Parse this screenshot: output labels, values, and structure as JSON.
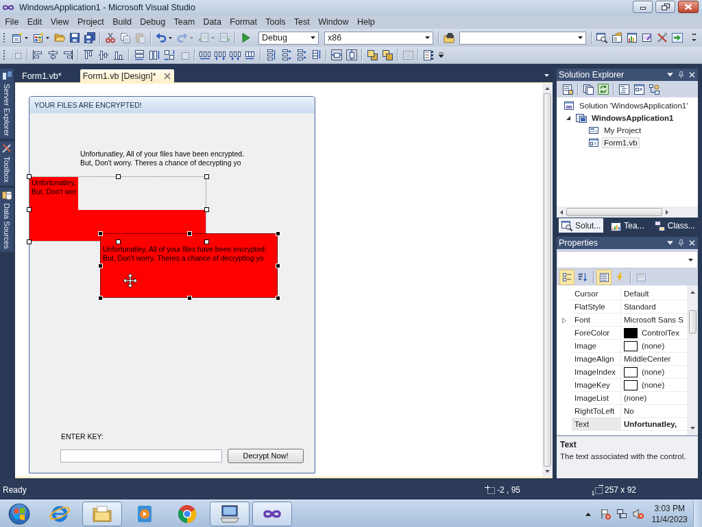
{
  "window": {
    "title": "WindowsApplication1 - Microsoft Visual Studio"
  },
  "menu": [
    "File",
    "Edit",
    "View",
    "Project",
    "Build",
    "Debug",
    "Team",
    "Data",
    "Format",
    "Tools",
    "Test",
    "Window",
    "Help"
  ],
  "standard_toolbar": {
    "configuration": "Debug",
    "platform": "x86",
    "buttons": [
      {
        "disabled": false
      },
      {
        "disabled": false
      },
      {
        "disabled": false
      },
      {
        "disabled": false
      },
      {
        "disabled": false
      },
      {
        "disabled": false
      },
      {
        "disabled": false
      },
      {
        "disabled": true
      },
      {
        "disabled": false
      },
      {
        "disabled": true
      },
      {
        "disabled": true
      },
      {
        "disabled": true
      },
      {
        "disabled": false
      },
      {
        "disabled": false
      },
      {
        "disabled": false
      },
      {
        "disabled": false
      },
      {
        "disabled": false
      },
      {
        "disabled": false
      },
      {
        "disabled": false
      },
      {
        "disabled": false
      }
    ]
  },
  "layout_toolbar": {
    "buttons": [
      {
        "disabled": true
      },
      {
        "disabled": false
      },
      {
        "disabled": false
      },
      {
        "disabled": false
      },
      {
        "disabled": false
      },
      {
        "disabled": false
      },
      {
        "disabled": false
      },
      {
        "disabled": false
      },
      {
        "disabled": false
      },
      {
        "disabled": false
      },
      {
        "disabled": true
      },
      {
        "disabled": false
      },
      {
        "disabled": false
      },
      {
        "disabled": false
      },
      {
        "disabled": false
      },
      {
        "disabled": false
      },
      {
        "disabled": false
      },
      {
        "disabled": false
      },
      {
        "disabled": false
      },
      {
        "disabled": false
      },
      {
        "disabled": false
      },
      {
        "disabled": false
      },
      {
        "disabled": false
      },
      {
        "disabled": true
      },
      {
        "disabled": false
      }
    ]
  },
  "side_tabs": [
    "Server Explorer",
    "Toolbox",
    "Data Sources"
  ],
  "document_tabs": [
    {
      "label": "Form1.vb*",
      "selected": false
    },
    {
      "label": "Form1.vb [Design]*",
      "selected": true
    }
  ],
  "form": {
    "title": "YOUR FILES ARE ENCRYPTED!",
    "controls": [
      {
        "kind": "label",
        "text": "Unfortunatley, All of your files have been encrypted.\nBut, Don't worry. Theres a chance of decrypting yo",
        "selected": false
      },
      {
        "kind": "label",
        "text": "Unfortunatley,\nBut, Don't wor",
        "color": "#ff0000",
        "selected": true,
        "primary": false
      },
      {
        "kind": "label",
        "text": "Unfortunatley, All of your files have been encrypted.\nBut, Don't worry. Theres a chance of decrypting yo",
        "color": "#ff0000",
        "selected": true,
        "primary": true
      },
      {
        "kind": "label",
        "text": "ENTER KEY:",
        "selected": false
      },
      {
        "kind": "textbox",
        "selected": false
      },
      {
        "kind": "button",
        "text": "Decrypt Now!",
        "selected": false
      }
    ]
  },
  "solution_explorer": {
    "title": "Solution Explorer",
    "tree": [
      {
        "kind": "solution",
        "label": "Solution 'WindowsApplication1'",
        "startup": false,
        "selected": false,
        "children": [
          {
            "kind": "project",
            "label": "WindowsApplication1",
            "startup": true,
            "selected": false,
            "expanded": true,
            "children": [
              {
                "kind": "folder",
                "label": "My Project",
                "startup": false,
                "selected": false
              },
              {
                "kind": "form",
                "label": "Form1.vb",
                "startup": false,
                "selected": true
              }
            ]
          }
        ]
      }
    ],
    "tabs": [
      {
        "label": "Solut...",
        "selected": true
      },
      {
        "label": "Tea...",
        "selected": false
      },
      {
        "label": "Class...",
        "selected": false
      }
    ]
  },
  "properties": {
    "title": "Properties",
    "toolbar": [
      {
        "selected": true,
        "disabled": false
      },
      {
        "selected": false,
        "disabled": false
      },
      {
        "selected": true,
        "disabled": false
      },
      {
        "selected": false,
        "disabled": false
      },
      {
        "selected": false,
        "disabled": true
      }
    ],
    "rows": [
      {
        "name": "Cursor",
        "value": "Default",
        "kind": "text",
        "modified": false,
        "selected": false
      },
      {
        "name": "FlatStyle",
        "value": "Standard",
        "kind": "text",
        "modified": false,
        "selected": false
      },
      {
        "name": "Font",
        "value": "Microsoft Sans S",
        "kind": "expandable",
        "expanded": false,
        "modified": false,
        "selected": false
      },
      {
        "name": "ForeColor",
        "value": "ControlTex",
        "kind": "swatch",
        "color": "#000000",
        "modified": false,
        "selected": false
      },
      {
        "name": "Image",
        "value": "(none)",
        "kind": "swatch",
        "color": "#ffffff",
        "modified": false,
        "selected": false
      },
      {
        "name": "ImageAlign",
        "value": "MiddleCenter",
        "kind": "text",
        "modified": false,
        "selected": false
      },
      {
        "name": "ImageIndex",
        "value": "(none)",
        "kind": "swatch",
        "color": "#ffffff",
        "modified": false,
        "selected": false
      },
      {
        "name": "ImageKey",
        "value": "(none)",
        "kind": "swatch",
        "color": "#ffffff",
        "modified": false,
        "selected": false
      },
      {
        "name": "ImageList",
        "value": "(none)",
        "kind": "text",
        "modified": false,
        "selected": false
      },
      {
        "name": "RightToLeft",
        "value": "No",
        "kind": "text",
        "modified": false,
        "selected": false
      },
      {
        "name": "Text",
        "value": "Unfortunatley,",
        "kind": "text",
        "modified": true,
        "selected": true
      }
    ],
    "description": {
      "title": "Text",
      "text": "The text associated with the control."
    }
  },
  "status_bar": {
    "text": "Ready",
    "position": "-2 , 95",
    "size": "257 x 92"
  },
  "taskbar": {
    "apps": [
      {
        "running": false
      },
      {
        "running": true
      },
      {
        "running": false
      },
      {
        "running": false
      },
      {
        "running": true
      },
      {
        "running": true
      }
    ],
    "time": "3:03 PM",
    "date": "11/4/2023"
  }
}
